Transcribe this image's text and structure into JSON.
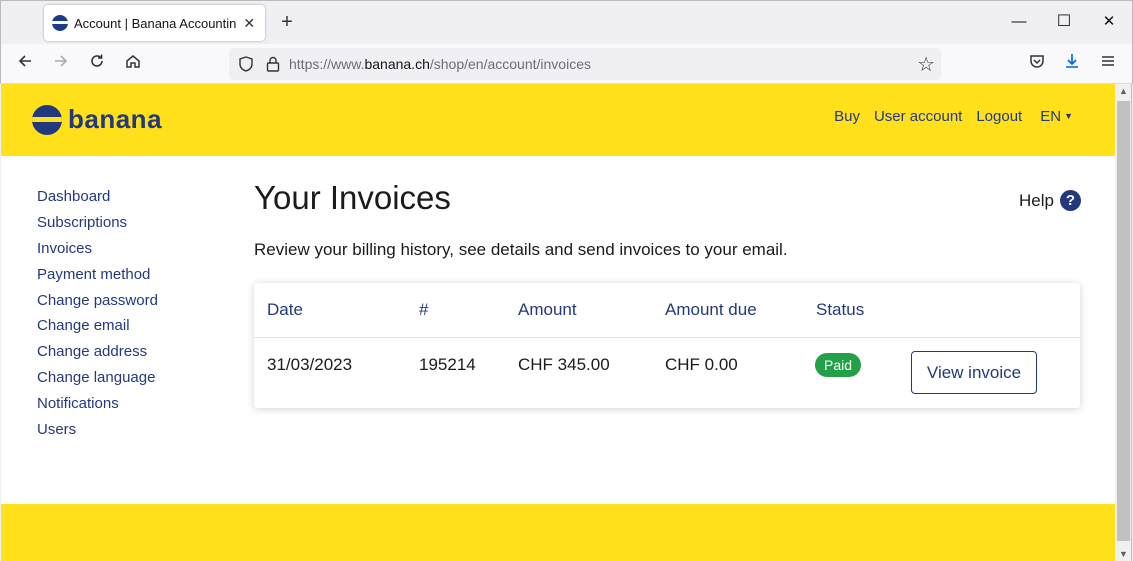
{
  "browser": {
    "tab_title": "Account | Banana Accounting S",
    "tab_close": "✕",
    "new_tab": "+",
    "url_prefix": "https://www.",
    "url_domain": "banana.ch",
    "url_path": "/shop/en/account/invoices",
    "window_controls": {
      "minimize": "—",
      "maximize": "☐",
      "close": "✕"
    },
    "icons": [
      "back-arrow-icon",
      "forward-arrow-icon",
      "reload-icon",
      "home-icon",
      "shield-icon",
      "lock-icon",
      "star-icon",
      "pocket-icon",
      "download-icon",
      "menu-icon"
    ]
  },
  "header": {
    "logo_text": "banana",
    "nav": [
      {
        "label": "Buy"
      },
      {
        "label": "User account"
      },
      {
        "label": "Logout"
      }
    ],
    "language": "EN"
  },
  "sidebar": {
    "items": [
      {
        "label": "Dashboard"
      },
      {
        "label": "Subscriptions"
      },
      {
        "label": "Invoices"
      },
      {
        "label": "Payment method"
      },
      {
        "label": "Change password"
      },
      {
        "label": "Change email"
      },
      {
        "label": "Change address"
      },
      {
        "label": "Change language"
      },
      {
        "label": "Notifications"
      },
      {
        "label": "Users"
      }
    ]
  },
  "main": {
    "title": "Your Invoices",
    "help_label": "Help",
    "subtitle": "Review your billing history, see details and send invoices to your email.",
    "table": {
      "columns": [
        "Date",
        "#",
        "Amount",
        "Amount due",
        "Status"
      ],
      "rows": [
        {
          "date": "31/03/2023",
          "number": "195214",
          "amount": "CHF 345.00",
          "amount_due": "CHF 0.00",
          "status": "Paid",
          "action": "View invoice"
        }
      ]
    }
  },
  "colors": {
    "brand_yellow": "#ffe01b",
    "brand_blue": "#23397e",
    "paid_green": "#24a148"
  }
}
